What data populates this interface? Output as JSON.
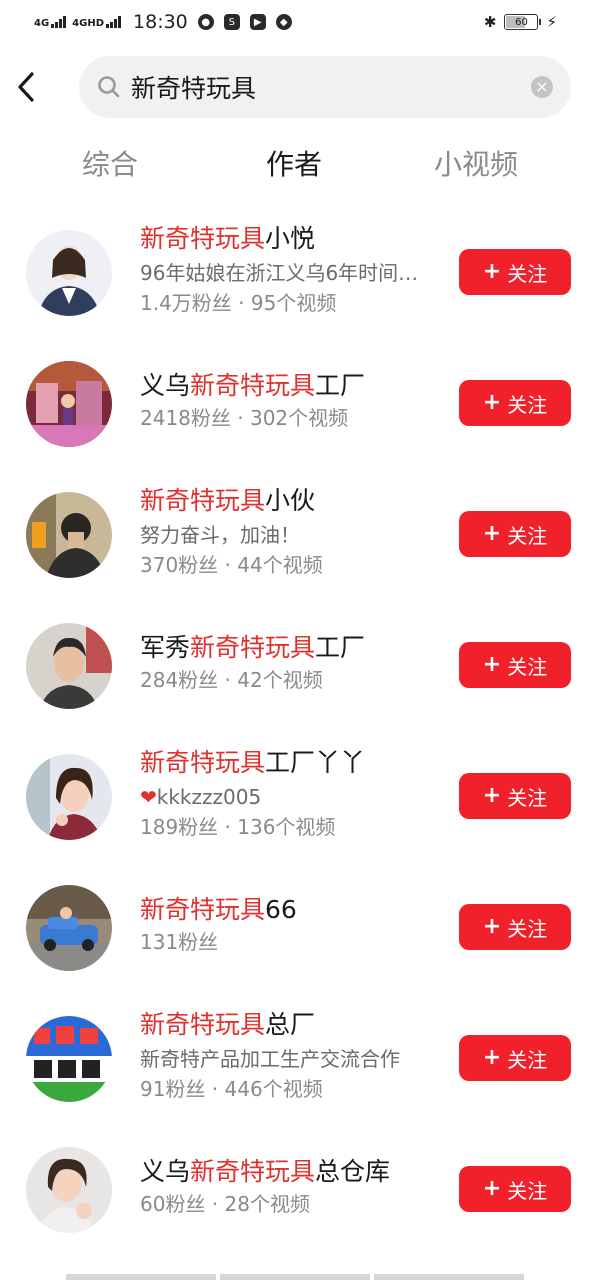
{
  "status_bar": {
    "net1": "4G",
    "net2": "4GHD",
    "time": "18:30",
    "battery": "60",
    "icons": [
      "wechat-icon",
      "s-app-icon",
      "video-app-icon",
      "compass-icon",
      "bluetooth-icon",
      "charging-icon"
    ]
  },
  "search": {
    "query": "新奇特玩具"
  },
  "tabs": [
    {
      "label": "综合",
      "active": false
    },
    {
      "label": "作者",
      "active": true
    },
    {
      "label": "小视频",
      "active": false
    }
  ],
  "authors": [
    {
      "name_pre": "",
      "name_hl": "新奇特玩具",
      "name_post": "小悦",
      "desc": "96年姑娘在浙江义乌6年时间…",
      "stats": "1.4万粉丝 · 95个视频",
      "follow": "关注"
    },
    {
      "name_pre": "义乌",
      "name_hl": "新奇特玩具",
      "name_post": "工厂",
      "desc": "",
      "stats": "2418粉丝 · 302个视频",
      "follow": "关注"
    },
    {
      "name_pre": "",
      "name_hl": "新奇特玩具",
      "name_post": "小伙",
      "desc": "努力奋斗，加油！",
      "stats": "370粉丝 · 44个视频",
      "follow": "关注"
    },
    {
      "name_pre": "军秀",
      "name_hl": "新奇特玩具",
      "name_post": "工厂",
      "desc": "",
      "stats": "284粉丝 · 42个视频",
      "follow": "关注"
    },
    {
      "name_pre": "",
      "name_hl": "新奇特玩具",
      "name_post": "工厂丫丫",
      "desc_heart": "❤",
      "desc": "kkkzzz005",
      "stats": "189粉丝 · 136个视频",
      "follow": "关注"
    },
    {
      "name_pre": "",
      "name_hl": "新奇特玩具",
      "name_post": "66",
      "desc": "",
      "stats": "131粉丝",
      "follow": "关注"
    },
    {
      "name_pre": "",
      "name_hl": "新奇特玩具",
      "name_post": "总厂",
      "desc": "新奇特产品加工生产交流合作",
      "stats": "91粉丝 · 446个视频",
      "follow": "关注"
    },
    {
      "name_pre": "义乌",
      "name_hl": "新奇特玩具",
      "name_post": "总仓库",
      "desc": "",
      "stats": "60粉丝 · 28个视频",
      "follow": "关注"
    }
  ],
  "colors": {
    "accent": "#f0212a",
    "highlight": "#e0312e"
  }
}
